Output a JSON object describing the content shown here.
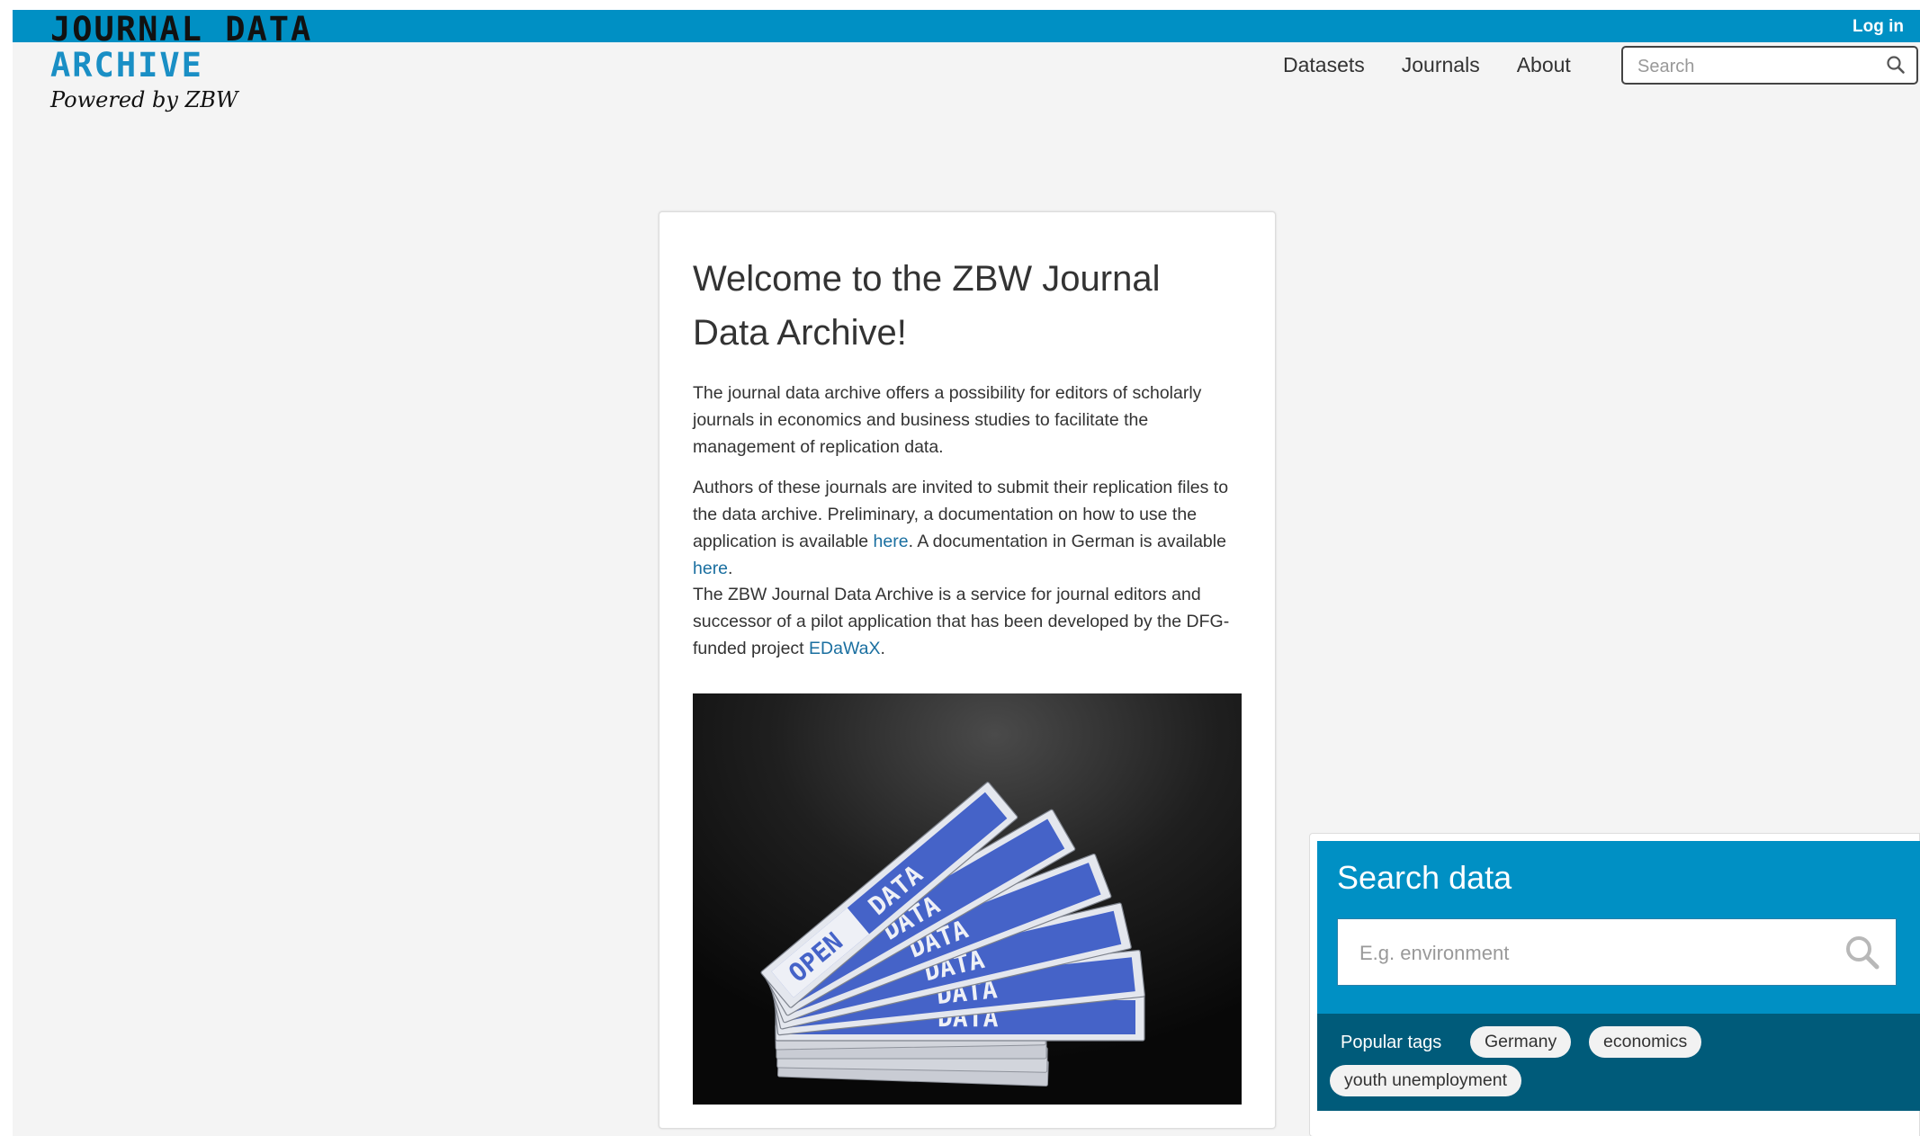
{
  "header": {
    "login_label": "Log in",
    "logo": {
      "line1": "JOURNAL DATA",
      "line2": "ARCHIVE",
      "tagline": "Powered by ZBW"
    },
    "nav": [
      {
        "label": "Datasets"
      },
      {
        "label": "Journals"
      },
      {
        "label": "About"
      }
    ],
    "search": {
      "placeholder": "Search"
    }
  },
  "welcome": {
    "title": "Welcome to the ZBW Journal Data Archive!",
    "p1": "The journal data archive offers a possibility for editors of scholarly journals in economics and business studies to facilitate the management of replication data.",
    "p2_a": "Authors of these journals are invited to submit their replication files to the data archive. Preliminary, a documentation on how to use the application is available ",
    "p2_link1": "here",
    "p2_b": ". A documentation in German is available ",
    "p2_link2": "here",
    "p2_c": ".",
    "p3_a": "The ZBW Journal Data Archive is a service for journal editors and successor of a pilot application that has been developed by the DFG-funded project ",
    "p3_link": "EDaWaX",
    "p3_b": ".",
    "image": {
      "card_texts": [
        "OPEN",
        "DATA",
        "DATA",
        "DATA",
        "DATA",
        "DATA"
      ]
    }
  },
  "search_panel": {
    "title": "Search data",
    "placeholder": "E.g. environment",
    "tags_label": "Popular tags",
    "tags": [
      "Germany",
      "economics",
      "youth unemployment"
    ]
  },
  "colors": {
    "topbar": "#0090c4",
    "tags_background": "#005b7a",
    "link": "#1a6fa0",
    "card_blue": "#4563c8"
  }
}
